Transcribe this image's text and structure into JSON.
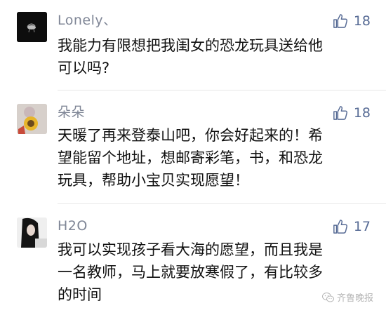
{
  "comments": [
    {
      "username": "Lonely、",
      "likes": "18",
      "text": "我能力有限想把我闺女的恐龙玩具送给他\n可以吗?",
      "avatar_icon": "dark-photo-avatar"
    },
    {
      "username": "朵朵",
      "likes": "18",
      "text": "天暖了再来登泰山吧，你会好起来的！希\n望能留个地址，想邮寄彩笔，书，和恐龙\n玩具，帮助小宝贝实现愿望！",
      "avatar_icon": "sunflower-avatar"
    },
    {
      "username": "H2O",
      "likes": "17",
      "text": "我可以实现孩子看大海的愿望，而且我是\n一名教师，马上就要放寒假了，有比较多\n的时间",
      "avatar_icon": "portrait-avatar"
    }
  ],
  "watermark": {
    "text": "齐鲁晚报",
    "icon": "wechat-logo-icon"
  },
  "colors": {
    "link_blue": "#576b95",
    "username_gray": "#7f8696",
    "text": "#111111"
  }
}
